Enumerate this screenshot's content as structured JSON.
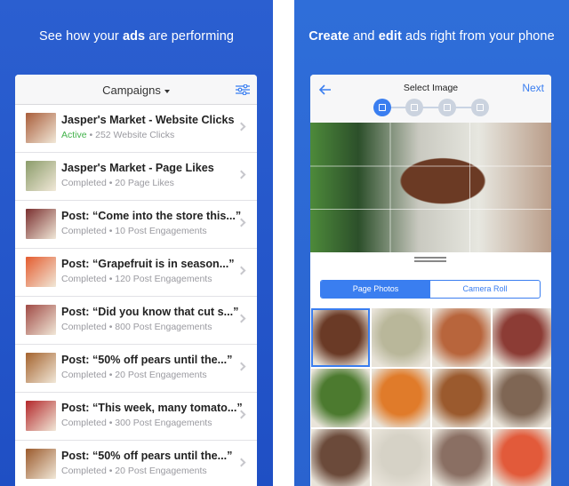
{
  "left": {
    "headline": {
      "pre": "See how your ",
      "strong": "ads",
      "post": " are performing"
    },
    "header": {
      "title": "Campaigns"
    },
    "campaigns": [
      {
        "title": "Jasper's Market - Website Clicks",
        "status": "Active",
        "metric": " • 252 Website Clicks",
        "color": "#a95d3a"
      },
      {
        "title": "Jasper's Market - Page Likes",
        "status": "Completed",
        "metric": " • 20 Page Likes",
        "color": "#8b9c6a"
      },
      {
        "title": "Post: “Come into the store this...”",
        "status": "Completed",
        "metric": " • 10 Post Engagements",
        "color": "#7a2f2f"
      },
      {
        "title": "Post: “Grapefruit is in season...”",
        "status": "Completed",
        "metric": " • 120 Post Engagements",
        "color": "#e45c2f"
      },
      {
        "title": "Post: “Did you know that cut s...”",
        "status": "Completed",
        "metric": " • 800 Post Engagements",
        "color": "#a04a45"
      },
      {
        "title": "Post: “50% off pears until the...”",
        "status": "Completed",
        "metric": " • 20 Post Engagements",
        "color": "#a4622d"
      },
      {
        "title": "Post: “This week, many tomato...”",
        "status": "Completed",
        "metric": " • 300 Post Engagements",
        "color": "#b3272a"
      },
      {
        "title": "Post: “50% off pears until the...”",
        "status": "Completed",
        "metric": " • 20 Post Engagements",
        "color": "#9b5a2c"
      }
    ]
  },
  "right": {
    "headline": {
      "strong1": "Create",
      "mid": " and ",
      "strong2": "edit",
      "post": " ads right from your phone"
    },
    "nav": {
      "title": "Select Image",
      "next": "Next"
    },
    "tabs": [
      "Page Photos",
      "Camera Roll"
    ],
    "gallery_colors": [
      "#6a3a26",
      "#b9b79a",
      "#b8653c",
      "#8c3c35",
      "#4c7a2f",
      "#e07b2a",
      "#9b5a2e",
      "#7f6654",
      "#6b4a3a",
      "#d6d2c6",
      "#8a6f63",
      "#e25a3a"
    ]
  },
  "accent": "#3a7ef0",
  "active_color": "#41b24a"
}
